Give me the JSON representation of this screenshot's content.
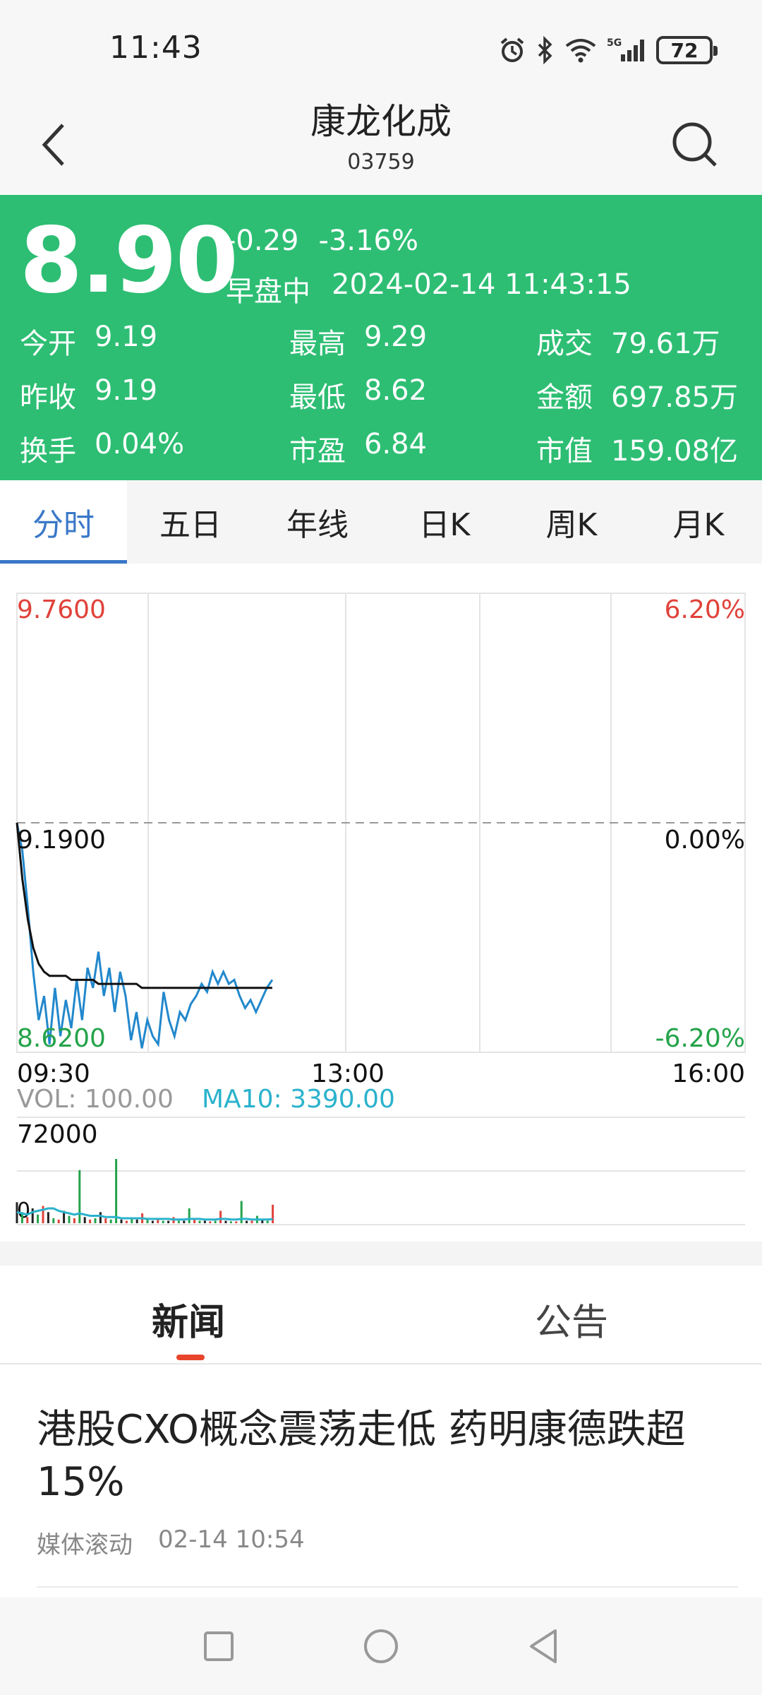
{
  "status_bar": {
    "time": "11:43",
    "battery": "72",
    "icons": [
      "alarm-icon",
      "bluetooth-icon",
      "wifi-icon",
      "signal-5g-icon",
      "battery-icon"
    ]
  },
  "header": {
    "name": "康龙化成",
    "code": "03759"
  },
  "quote": {
    "price": "8.90",
    "change": "-0.29",
    "change_pct": "-3.16%",
    "session": "早盘中",
    "datetime": "2024-02-14 11:43:15",
    "stats": [
      {
        "label": "今开",
        "value": "9.19"
      },
      {
        "label": "最高",
        "value": "9.29"
      },
      {
        "label": "成交",
        "value": "79.61万"
      },
      {
        "label": "昨收",
        "value": "9.19"
      },
      {
        "label": "最低",
        "value": "8.62"
      },
      {
        "label": "金额",
        "value": "697.85万"
      },
      {
        "label": "换手",
        "value": "0.04%"
      },
      {
        "label": "市盈",
        "value": "6.84"
      },
      {
        "label": "市值",
        "value": "159.08亿"
      }
    ]
  },
  "tabs": [
    "分时",
    "五日",
    "年线",
    "日K",
    "周K",
    "月K"
  ],
  "active_tab": 0,
  "chart": {
    "price_high": "9.7600",
    "price_prev": "9.1900",
    "price_low": "8.6200",
    "pct_high": "6.20%",
    "pct_zero": "0.00%",
    "pct_low": "-6.20%",
    "time_start": "09:30",
    "time_mid": "13:00",
    "time_end": "16:00",
    "vol_label": "VOL: 100.00",
    "ma_label": "MA10: 3390.00",
    "vol_max": "72000",
    "vol_zero": "0"
  },
  "chart_data": {
    "type": "line",
    "title": "",
    "xlabel": "",
    "ylabel": "",
    "ylim": [
      8.62,
      9.76
    ],
    "x_ticks": [
      "09:30",
      "13:00",
      "16:00"
    ],
    "series": [
      {
        "values": [
          9.19,
          9.12,
          8.98,
          8.82,
          8.7,
          8.76,
          8.64,
          8.78,
          8.66,
          8.75,
          8.68,
          8.8,
          8.7,
          8.83,
          8.78,
          8.87,
          8.76,
          8.83,
          8.72,
          8.82,
          8.76,
          8.65,
          8.72,
          8.63,
          8.7,
          8.66,
          8.64,
          8.77,
          8.7,
          8.66,
          8.72,
          8.7,
          8.74,
          8.76,
          8.79,
          8.77,
          8.82,
          8.79,
          8.82,
          8.79,
          8.8,
          8.76,
          8.73,
          8.75,
          8.72,
          8.75,
          8.78,
          8.8
        ]
      },
      {
        "values": [
          9.19,
          9.05,
          8.95,
          8.88,
          8.84,
          8.82,
          8.81,
          8.81,
          8.81,
          8.81,
          8.8,
          8.8,
          8.8,
          8.8,
          8.8,
          8.79,
          8.79,
          8.79,
          8.79,
          8.79,
          8.79,
          8.79,
          8.79,
          8.78,
          8.78,
          8.78,
          8.78,
          8.78,
          8.78,
          8.78,
          8.78,
          8.78,
          8.78,
          8.78,
          8.78,
          8.78,
          8.78,
          8.78,
          8.78,
          8.78,
          8.78,
          8.78,
          8.78,
          8.78,
          8.78,
          8.78,
          8.78,
          8.78
        ]
      }
    ],
    "volume": {
      "ylim": [
        0,
        72000
      ],
      "values": [
        17000,
        9000,
        5000,
        12000,
        7000,
        14000,
        9000,
        4000,
        3000,
        10000,
        6000,
        4000,
        43000,
        5000,
        3000,
        4000,
        9000,
        4000,
        3000,
        52000,
        3000,
        2000,
        4000,
        3000,
        8000,
        3000,
        2000,
        3000,
        2000,
        2000,
        5000,
        2000,
        2000,
        12000,
        3000,
        2000,
        2000,
        1500,
        2000,
        10000,
        2000,
        1500,
        1500,
        18000,
        2000,
        2000,
        6000,
        3000,
        2000,
        15000
      ],
      "colors": [
        "black",
        "green",
        "red",
        "black",
        "green",
        "red",
        "black",
        "green",
        "red",
        "black",
        "green",
        "red",
        "green",
        "black",
        "red",
        "green",
        "black",
        "red",
        "green",
        "green",
        "black",
        "red",
        "green",
        "black",
        "red",
        "green",
        "black",
        "red",
        "green",
        "black",
        "red",
        "green",
        "black",
        "green",
        "red",
        "green",
        "black",
        "red",
        "green",
        "red",
        "black",
        "green",
        "red",
        "green",
        "black",
        "red",
        "green",
        "black",
        "green",
        "red"
      ],
      "ma10": [
        9000,
        8000,
        7000,
        9000,
        10000,
        11000,
        12000,
        12000,
        10000,
        9000,
        8000,
        7000,
        8000,
        7000,
        6000,
        6000,
        6000,
        5000,
        5000,
        5000,
        4000,
        4000,
        4000,
        4000,
        4000,
        3500,
        3500,
        3500,
        3500,
        3500,
        3000,
        3000,
        3000,
        3500,
        3500,
        3500,
        3000,
        3000,
        3000,
        3500,
        3500,
        3000,
        3000,
        3500,
        3500,
        3000,
        3000,
        3000,
        3000,
        3390
      ]
    }
  },
  "news": {
    "tab_news": "新闻",
    "tab_announce": "公告",
    "article_title": "港股CXO概念震荡走低 药明康德跌超15%",
    "article_source": "媒体滚动",
    "article_time": "02-14 10:54"
  },
  "colors": {
    "green": "#2dbe73",
    "accent_blue": "#3a78c8",
    "up_red": "#e0423a",
    "down_green": "#24a34a",
    "price_line": "#2288cc",
    "avg_line": "#111111",
    "ma_cyan": "#2ab2cc"
  }
}
